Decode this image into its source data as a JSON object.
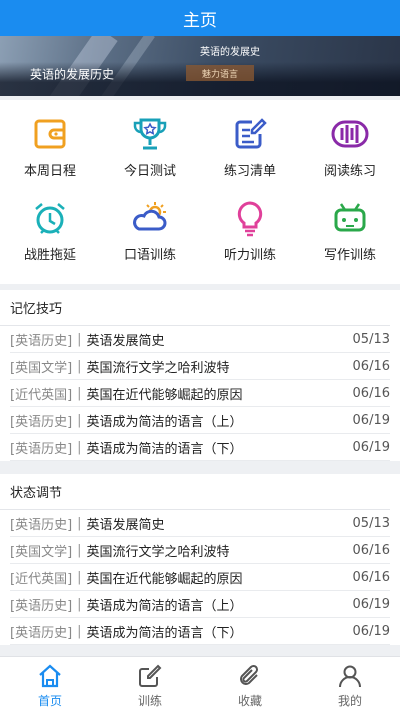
{
  "header": {
    "title": "主页"
  },
  "banner": {
    "caption": "英语的发展历史",
    "sign_text": "英语的发展史",
    "tag_text": "魅力语言"
  },
  "features": [
    {
      "label": "本周日程",
      "icon": "wallet-icon",
      "color": "#f0a020"
    },
    {
      "label": "今日测试",
      "icon": "trophy-icon",
      "color": "#18a0b8"
    },
    {
      "label": "练习清单",
      "icon": "edit-list-icon",
      "color": "#3b5cc8"
    },
    {
      "label": "阅读练习",
      "icon": "audio-wave-icon",
      "color": "#8a2aa8"
    },
    {
      "label": "战胜拖延",
      "icon": "alarm-clock-icon",
      "color": "#1ab0b8"
    },
    {
      "label": "口语训练",
      "icon": "cloud-sun-icon",
      "color": "#3b5cc8"
    },
    {
      "label": "听力训练",
      "icon": "lightbulb-icon",
      "color": "#e0409a"
    },
    {
      "label": "写作训练",
      "icon": "robot-icon",
      "color": "#2aa84a"
    }
  ],
  "sections": [
    {
      "title": "记忆技巧",
      "items": [
        {
          "category": "[英语历史]",
          "title": "英语发展简史",
          "date": "05/13"
        },
        {
          "category": "[英国文学]",
          "title": "英国流行文学之哈利波特",
          "date": "06/16"
        },
        {
          "category": "[近代英国]",
          "title": "英国在近代能够崛起的原因",
          "date": "06/16"
        },
        {
          "category": "[英语历史]",
          "title": "英语成为简洁的语言（上）",
          "date": "06/19"
        },
        {
          "category": "[英语历史]",
          "title": "英语成为简洁的语言（下）",
          "date": "06/19"
        }
      ]
    },
    {
      "title": "状态调节",
      "items": [
        {
          "category": "[英语历史]",
          "title": "英语发展简史",
          "date": "05/13"
        },
        {
          "category": "[英国文学]",
          "title": "英国流行文学之哈利波特",
          "date": "06/16"
        },
        {
          "category": "[近代英国]",
          "title": "英国在近代能够崛起的原因",
          "date": "06/16"
        },
        {
          "category": "[英语历史]",
          "title": "英语成为简洁的语言（上）",
          "date": "06/19"
        },
        {
          "category": "[英语历史]",
          "title": "英语成为简洁的语言（下）",
          "date": "06/19"
        }
      ]
    }
  ],
  "separator": "|",
  "tabs": [
    {
      "label": "首页",
      "icon": "home-icon",
      "active": true
    },
    {
      "label": "训练",
      "icon": "edit-icon",
      "active": false
    },
    {
      "label": "收藏",
      "icon": "paperclip-icon",
      "active": false
    },
    {
      "label": "我的",
      "icon": "user-icon",
      "active": false
    }
  ],
  "colors": {
    "brand": "#1a8cf0",
    "inactive_tab": "#666666"
  }
}
